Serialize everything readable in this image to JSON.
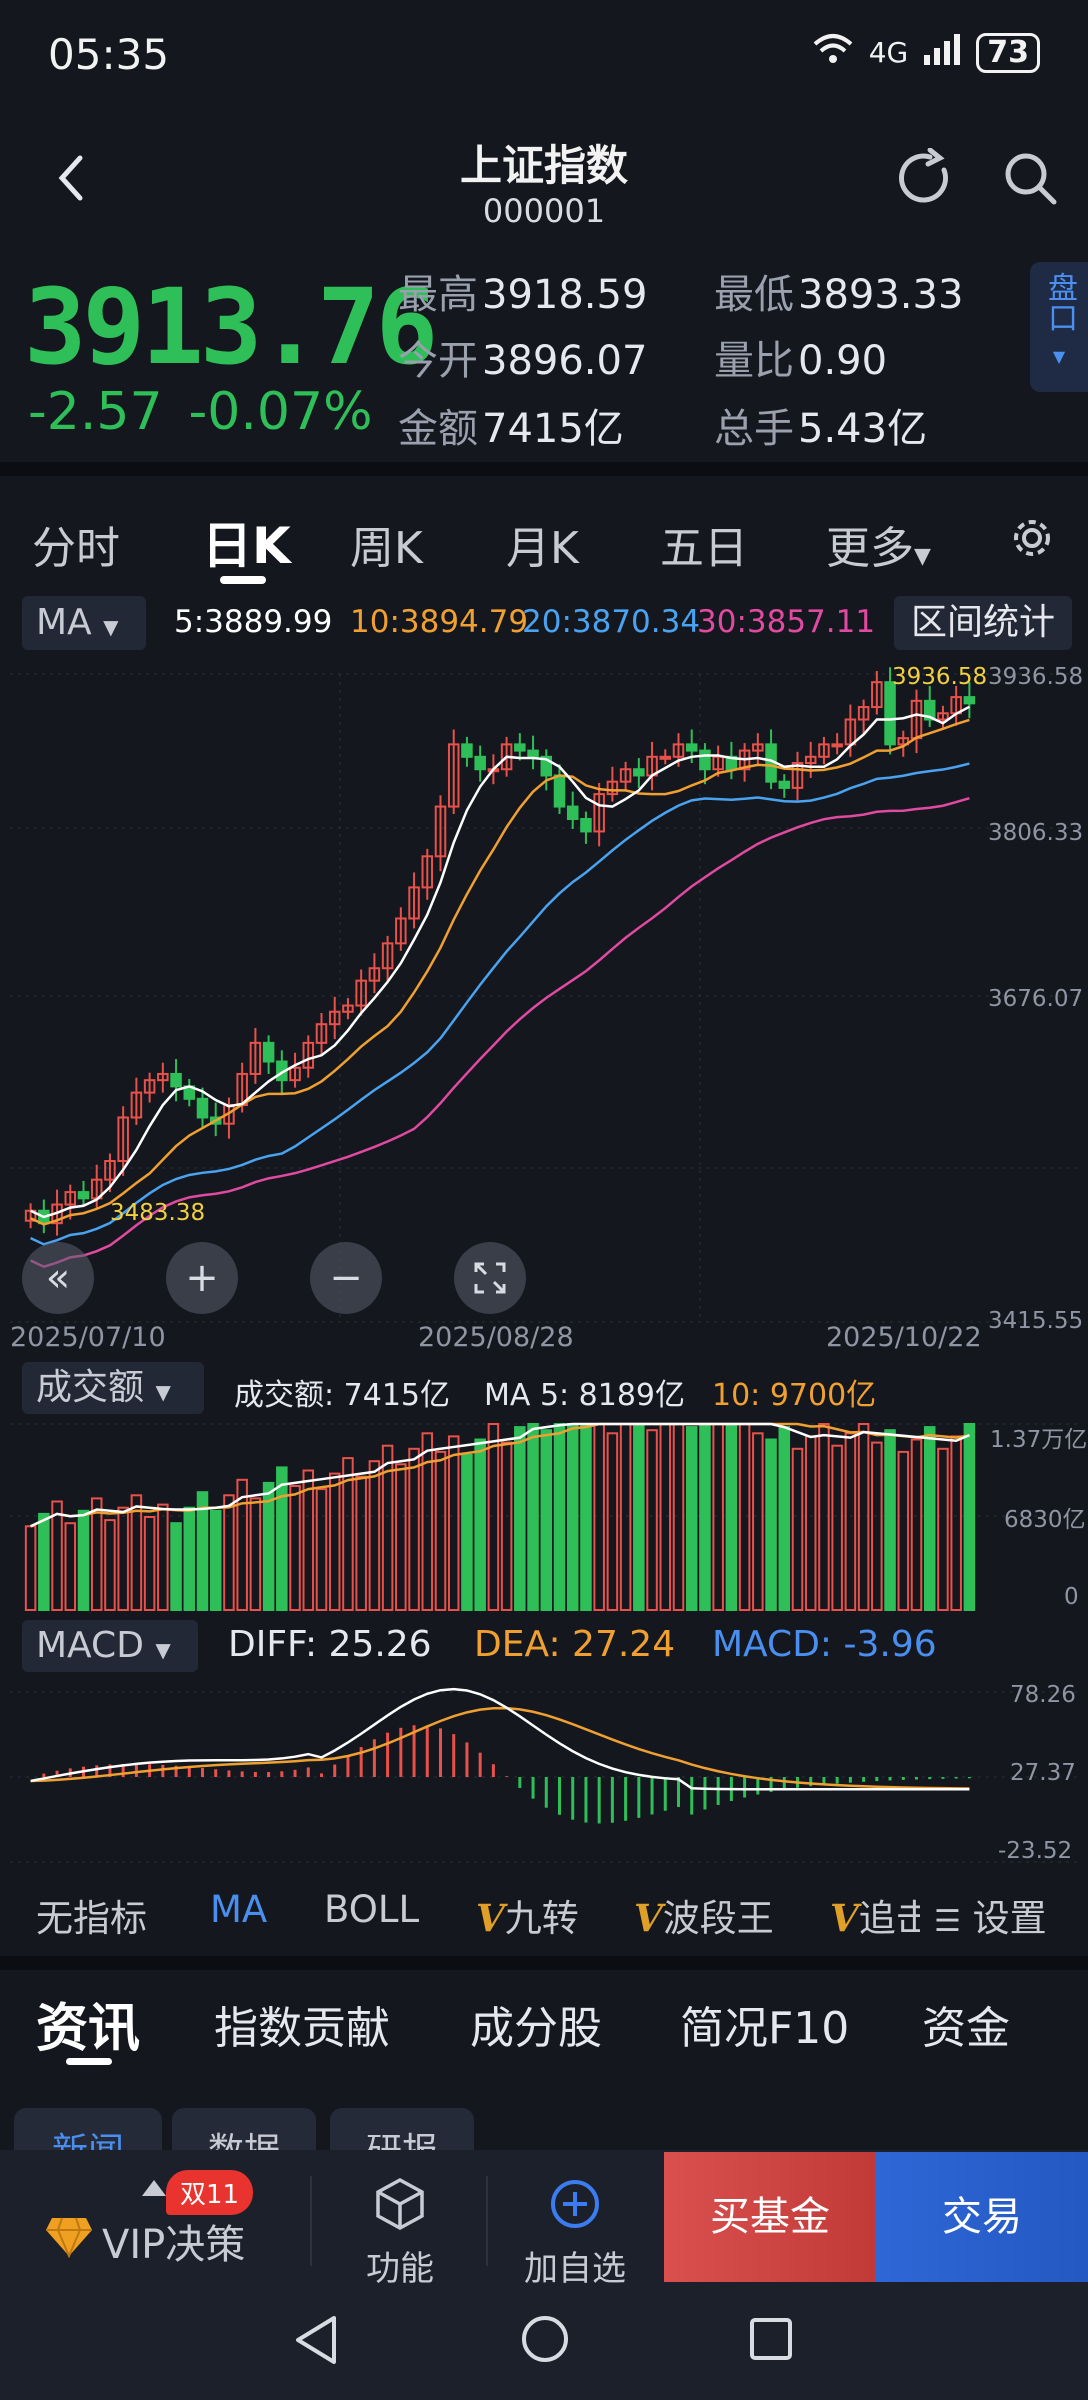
{
  "status": {
    "time": "05:35",
    "signal": "4G",
    "battery": "73"
  },
  "header": {
    "title": "上证指数",
    "code": "000001"
  },
  "quote": {
    "price": "3913.76",
    "change": "-2.57",
    "change_pct": "-0.07%",
    "high_label": "最高",
    "high": "3918.59",
    "low_label": "最低",
    "low": "3893.33",
    "open_label": "今开",
    "open": "3896.07",
    "ratio_label": "量比",
    "ratio": "0.90",
    "amount_label": "金额",
    "amount": "7415亿",
    "hands_label": "总手",
    "hands": "5.43亿",
    "pankou": "盘口"
  },
  "tabs": [
    "分时",
    "日K",
    "周K",
    "月K",
    "五日",
    "更多"
  ],
  "active_tab": "日K",
  "ma": {
    "selector": "MA",
    "ma5": "5:3889.99",
    "ma10": "10:3894.79",
    "ma20": "20:3870.34",
    "ma30": "30:3857.11",
    "interval_stats": "区间统计"
  },
  "kline_axis": {
    "y_top": "3936.58",
    "y_2": "3806.33",
    "y_3": "3676.07",
    "y_bottom": "3415.55"
  },
  "kline_labels": {
    "high_marker": "3936.58",
    "low_marker": "3483.38"
  },
  "dates": {
    "start": "2025/07/10",
    "mid": "2025/08/28",
    "end": "2025/10/22"
  },
  "volume": {
    "selector": "成交额",
    "amount": "成交额: 7415亿",
    "ma5": "MA 5: 8189亿",
    "ma10": "10: 9700亿",
    "axis_top": "1.37万亿",
    "axis_mid": "6830亿",
    "axis_bottom": "0"
  },
  "macd": {
    "selector": "MACD",
    "diff": "DIFF: 25.26",
    "dea": "DEA: 27.24",
    "macd": "MACD: -3.96",
    "axis_top": "78.26",
    "axis_mid": "27.37",
    "axis_bottom": "-23.52"
  },
  "indicators": [
    "无指标",
    "MA",
    "BOLL",
    "九转",
    "波段王",
    "追击",
    "设置"
  ],
  "v_mark": "V",
  "bottom_tabs": [
    "资讯",
    "指数贡献",
    "成分股",
    "简况F10",
    "资金"
  ],
  "sub_tabs": [
    "新闻",
    "数据",
    "研报"
  ],
  "bottom_bar": {
    "badge": "双11",
    "vip": "VIP决策",
    "func": "功能",
    "add": "加自选",
    "buy_fund": "买基金",
    "trade": "交易"
  },
  "colors": {
    "up": "#e8524a",
    "down": "#2fbf58",
    "ma5": "#ffffff",
    "ma10": "#f0a030",
    "ma20": "#4aa3f0",
    "ma30": "#e04aa0"
  },
  "chart_data": {
    "type": "candlestick",
    "x_range": [
      "2025/07/10",
      "2025/10/22"
    ],
    "ylim": [
      3415.55,
      3936.58
    ],
    "ma_series": [
      {
        "name": "5",
        "last": 3889.99
      },
      {
        "name": "10",
        "last": 3894.79
      },
      {
        "name": "20",
        "last": 3870.34
      },
      {
        "name": "30",
        "last": 3857.11
      }
    ],
    "close_approx": [
      3505,
      3495,
      3510,
      3520,
      3515,
      3530,
      3545,
      3580,
      3600,
      3610,
      3615,
      3605,
      3595,
      3580,
      3575,
      3590,
      3615,
      3640,
      3625,
      3610,
      3620,
      3640,
      3655,
      3665,
      3670,
      3690,
      3700,
      3720,
      3740,
      3765,
      3790,
      3830,
      3880,
      3870,
      3860,
      3860,
      3880,
      3875,
      3870,
      3855,
      3830,
      3820,
      3810,
      3840,
      3850,
      3860,
      3855,
      3870,
      3870,
      3880,
      3875,
      3860,
      3870,
      3860,
      3875,
      3880,
      3850,
      3845,
      3865,
      3870,
      3880,
      3880,
      3900,
      3910,
      3930,
      3880,
      3885,
      3915,
      3900,
      3905,
      3918,
      3913
    ],
    "volume_axis": [
      "0",
      "6830亿",
      "1.37万亿"
    ],
    "macd_last": {
      "diff": 25.26,
      "dea": 27.24,
      "macd": -3.96
    },
    "macd_axis": [
      -23.52,
      27.37,
      78.26
    ]
  }
}
